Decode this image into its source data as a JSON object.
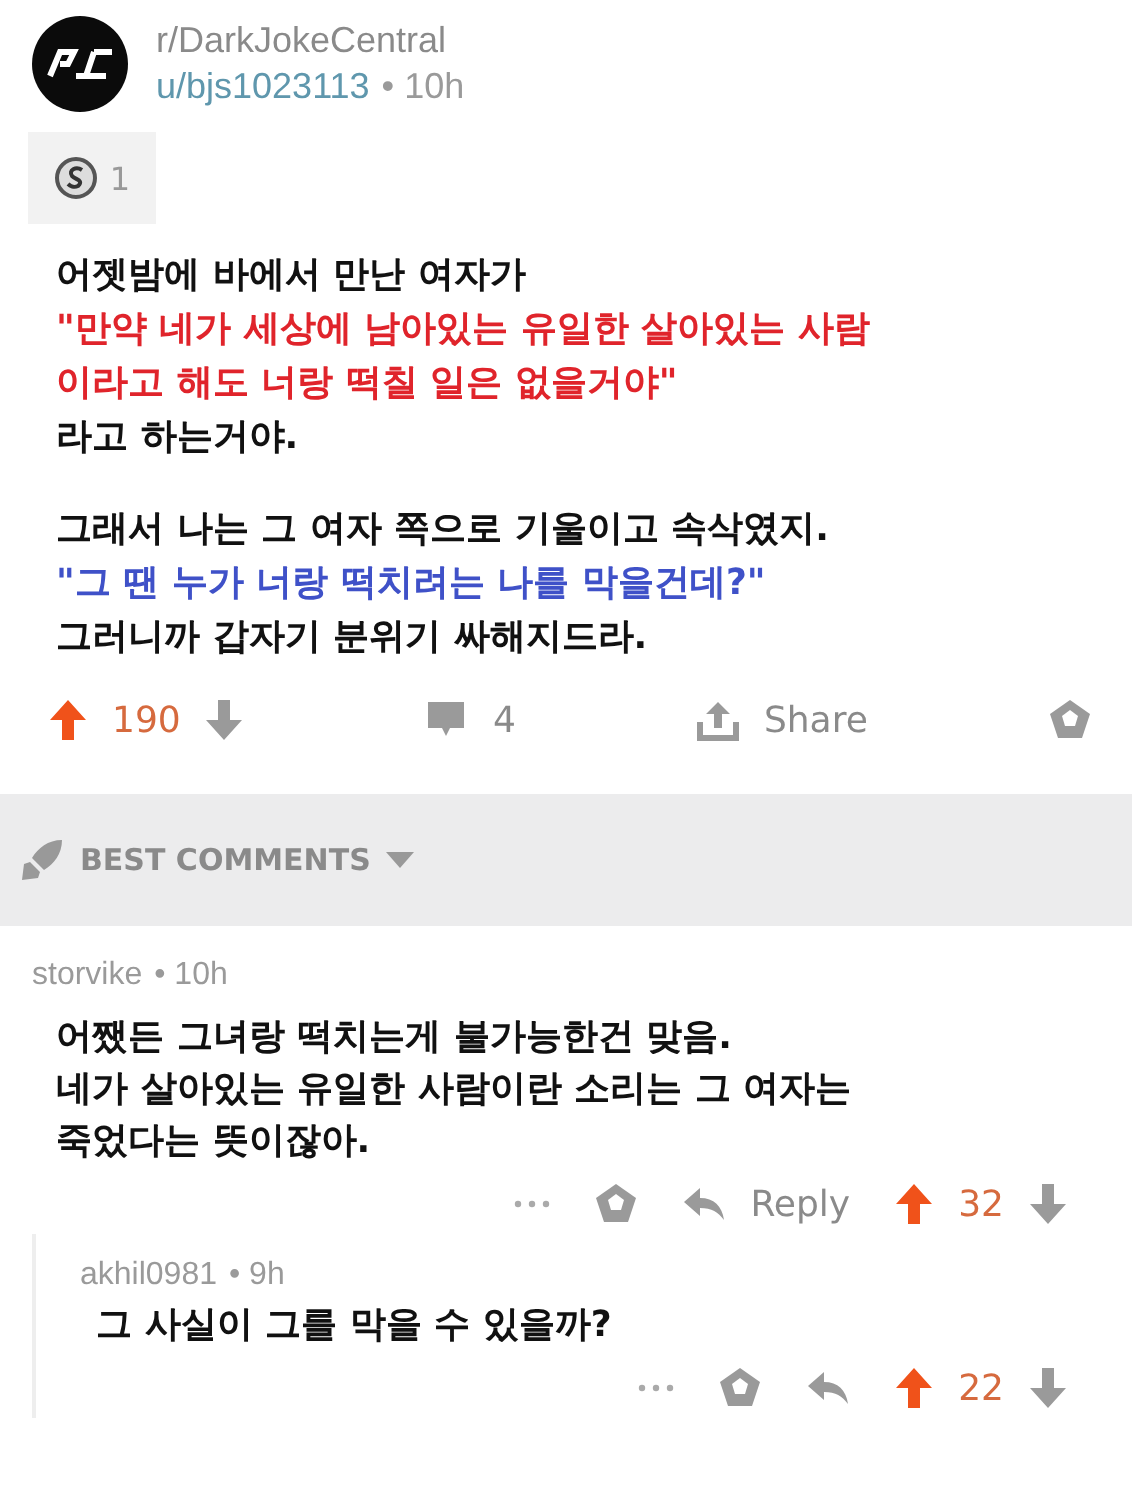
{
  "post": {
    "subreddit": "r/DarkJokeCentral",
    "author": "u/bjs1023113",
    "time": "• 10h",
    "award": {
      "count": "1"
    },
    "paragraphs": [
      [
        {
          "text": "어젯밤에 바에서 만난 여자가",
          "color": "#111111"
        },
        {
          "text": "\"만약 네가 세상에 남아있는 유일한 살아있는 사람",
          "color": "#e0242b"
        },
        {
          "text": "이라고 해도 너랑 떡칠 일은 없을거야\"",
          "color": "#e0242b"
        },
        {
          "text": "라고 하는거야.",
          "color": "#111111"
        }
      ],
      [
        {
          "text": "그래서 나는 그 여자 쪽으로 기울이고 속삭였지.",
          "color": "#111111"
        },
        {
          "text": "\"그 땐 누가 너랑 떡치려는 나를 막을건데?\"",
          "color": "#3f51c8"
        },
        {
          "text": "그러니까 갑자기 분위기 싸해지드라.",
          "color": "#111111"
        }
      ]
    ],
    "votes": "190",
    "upvoted": true,
    "comments": "4",
    "share": "Share"
  },
  "sort": {
    "label": "BEST COMMENTS"
  },
  "comments": [
    {
      "author": "storvike",
      "time": "• 10h",
      "nested": false,
      "lines": [
        "어쨌든 그녀랑 떡치는게 불가능한건 맞음.",
        "네가 살아있는 유일한 사람이란 소리는 그 여자는",
        "죽었다는 뜻이잖아."
      ],
      "reply": "Reply",
      "votes": "32",
      "upvoted": true
    },
    {
      "author": "akhil0981",
      "time": "• 9h",
      "nested": true,
      "lines": [
        "그 사실이 그를 막을 수 있을까?"
      ],
      "votes": "22",
      "upvoted": true
    }
  ]
}
